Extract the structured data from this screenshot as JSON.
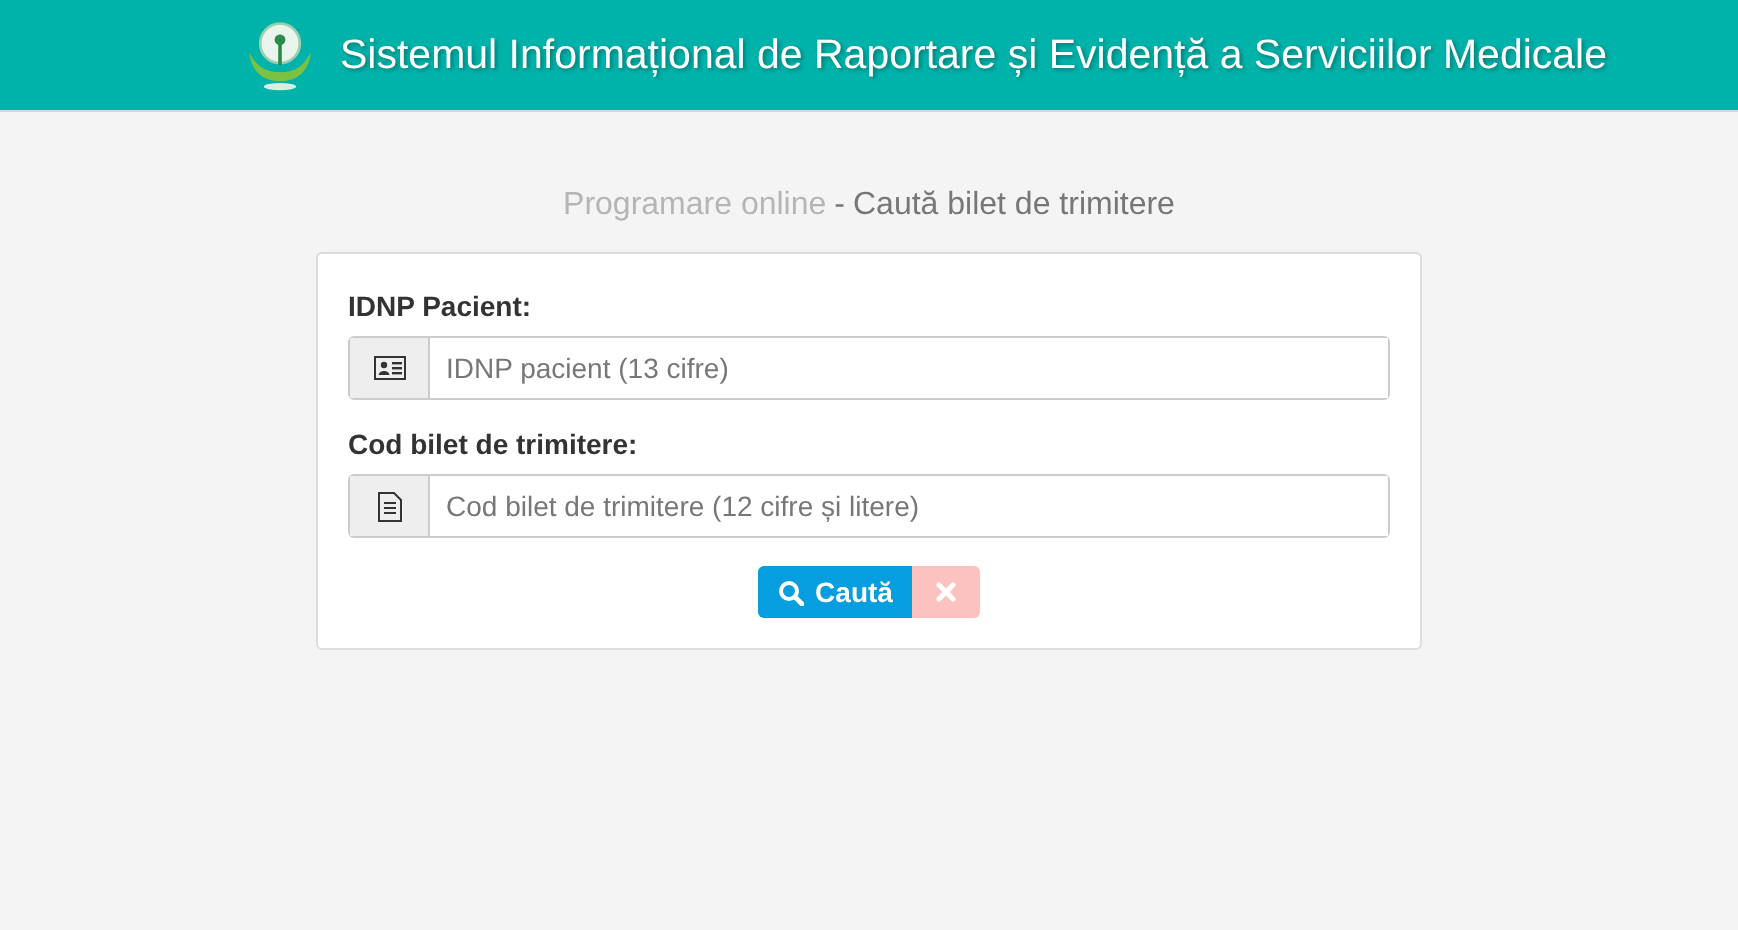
{
  "header": {
    "title": "Sistemul Informațional de Raportare și Evidență a Serviciilor Medicale"
  },
  "page_title": {
    "section": "Programare online",
    "separator": "-",
    "subtitle": "Caută bilet de trimitere"
  },
  "fields": [
    {
      "label": "IDNP Pacient:",
      "kind": "id-card",
      "placeholder": "IDNP pacient (13 cifre)"
    },
    {
      "label": "Cod bilet de trimitere:",
      "kind": "document",
      "placeholder": "Cod bilet de trimitere (12 cifre și litere)"
    }
  ],
  "search_button": {
    "label": "Caută"
  },
  "clear_button": {
    "disabled": true
  }
}
